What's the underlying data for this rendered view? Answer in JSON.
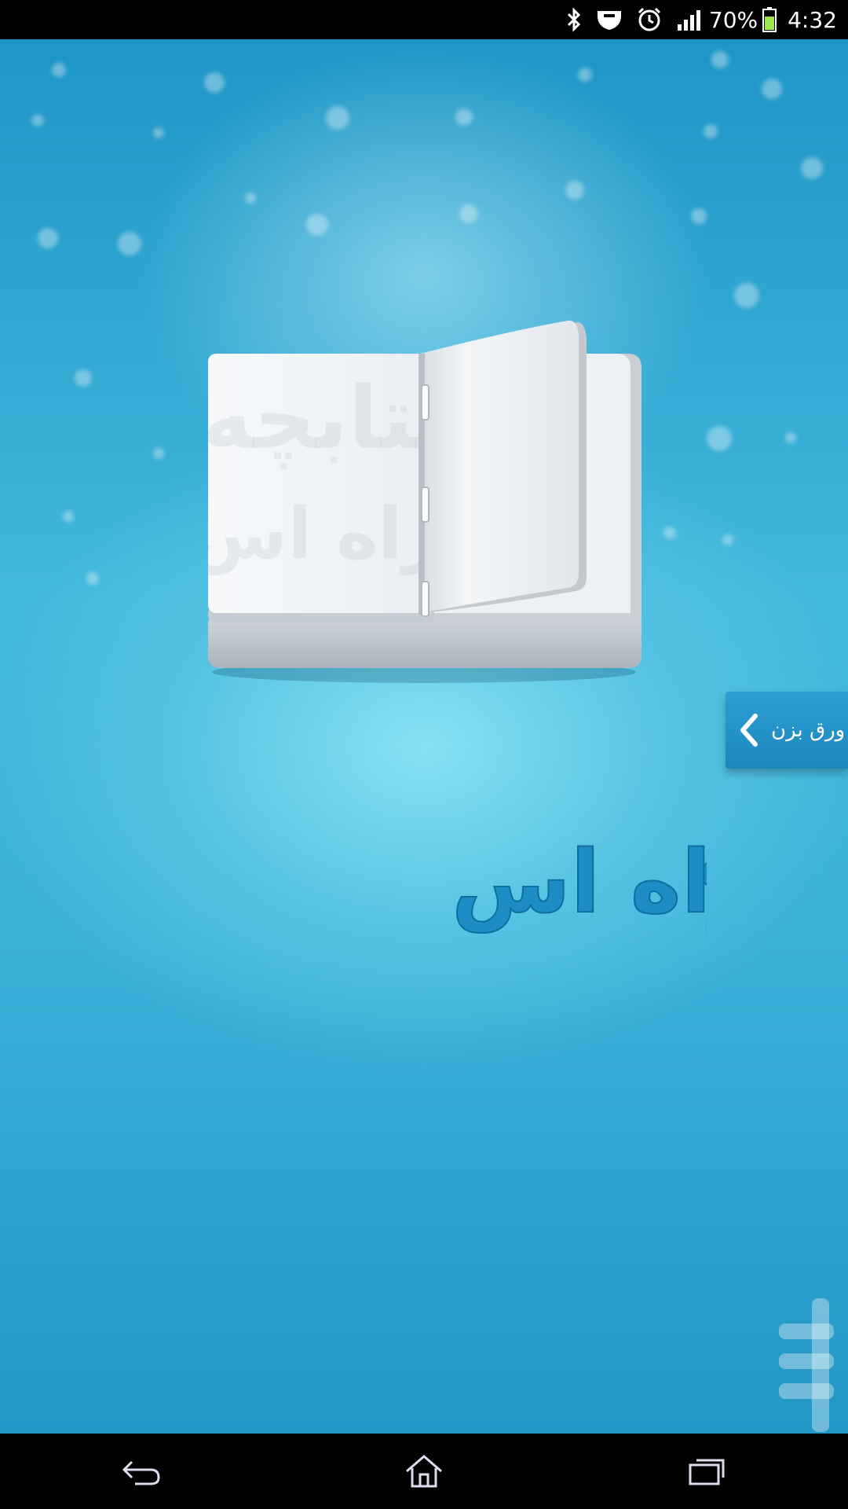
{
  "status_bar": {
    "battery_percent": "70%",
    "time": "4:32",
    "icons": [
      "bluetooth-icon",
      "shield-icon",
      "alarm-icon",
      "signal-icon",
      "battery-icon"
    ]
  },
  "app": {
    "title_line1": "کتابچه",
    "title_line2": "اسراه اس",
    "flip_tab_label": "ورق بزن",
    "book_watermark_line1": "کتابچه",
    "book_watermark_line2": "اسراه اس"
  },
  "colors": {
    "background_top": "#1e95c6",
    "background_glow": "#86e2f2",
    "logo_blue": "#1d8cc4",
    "tab_blue": "#2d9fd3"
  },
  "nav_bar": {
    "buttons": [
      "back-icon",
      "home-icon",
      "recent-apps-icon"
    ]
  }
}
